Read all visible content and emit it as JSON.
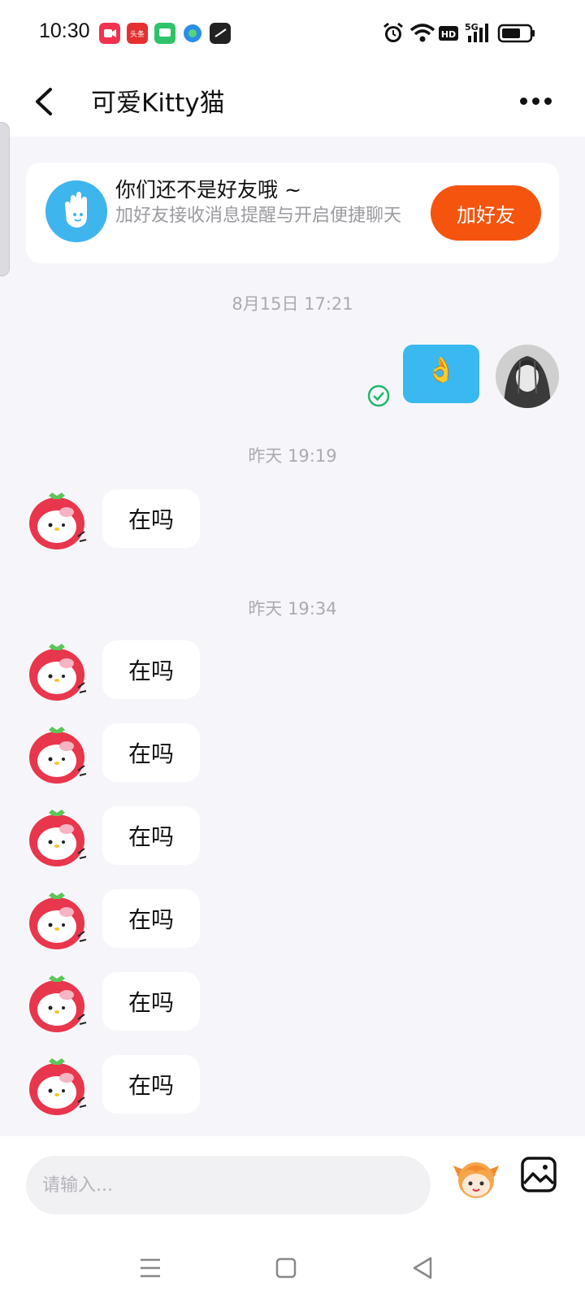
{
  "status_bar": {
    "time": "10:30",
    "app_icons": [
      "video-app-icon",
      "toutiao-app-icon",
      "messages-app-icon",
      "browser-app-icon",
      "clock-app-icon"
    ],
    "app_icon_colors": [
      "#f2334f",
      "#e53030",
      "#2ec36a",
      "#2a8ee6",
      "#222222"
    ],
    "toutiao_label": "头条",
    "network_label": "5G",
    "hd_label": "HD"
  },
  "header": {
    "title": "可爱Kitty猫"
  },
  "friend_card": {
    "title": "你们还不是好友哦 ~",
    "description": "加好友接收消息提醒与开启便捷聊天",
    "button_label": "加好友"
  },
  "timestamps": [
    "8月15日 17:21",
    "昨天 19:19",
    "昨天 19:34"
  ],
  "messages": [
    {
      "text": "在吗"
    },
    {
      "text": "在吗"
    },
    {
      "text": "在吗"
    },
    {
      "text": "在吗"
    },
    {
      "text": "在吗"
    },
    {
      "text": "在吗"
    },
    {
      "text": "在吗"
    }
  ],
  "outgoing": {
    "emoji": "👌"
  },
  "input": {
    "placeholder": "请输入..."
  },
  "colors": {
    "accent_orange": "#f5540f",
    "bubble_blue": "#3ab8f0",
    "sent_green": "#1fb86a"
  }
}
